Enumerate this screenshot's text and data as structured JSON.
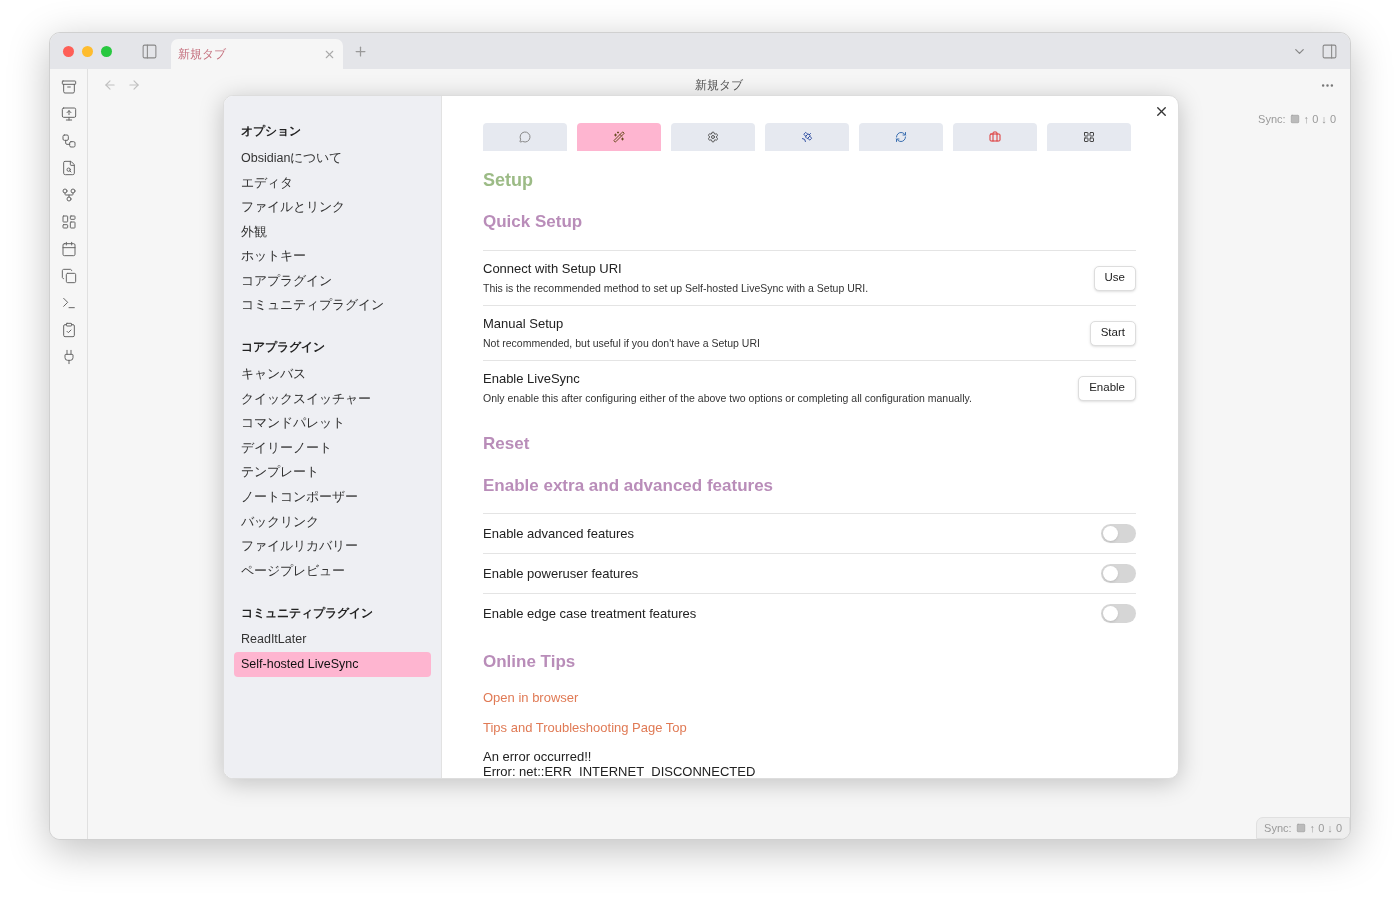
{
  "window": {
    "tab_title": "新規タブ",
    "page_title": "新規タブ"
  },
  "sync_top": {
    "label": "Sync:",
    "counts": "↑ 0 ↓ 0"
  },
  "sync_status": {
    "label": "Sync:",
    "counts": "↑ 0 ↓ 0"
  },
  "sidebar": {
    "sections": [
      {
        "heading": "オプション",
        "items": [
          {
            "label": "Obsidianについて",
            "selected": false
          },
          {
            "label": "エディタ",
            "selected": false
          },
          {
            "label": "ファイルとリンク",
            "selected": false
          },
          {
            "label": "外観",
            "selected": false
          },
          {
            "label": "ホットキー",
            "selected": false
          },
          {
            "label": "コアプラグイン",
            "selected": false
          },
          {
            "label": "コミュニティプラグイン",
            "selected": false
          }
        ]
      },
      {
        "heading": "コアプラグイン",
        "items": [
          {
            "label": "キャンバス",
            "selected": false
          },
          {
            "label": "クイックスイッチャー",
            "selected": false
          },
          {
            "label": "コマンドパレット",
            "selected": false
          },
          {
            "label": "デイリーノート",
            "selected": false
          },
          {
            "label": "テンプレート",
            "selected": false
          },
          {
            "label": "ノートコンポーザー",
            "selected": false
          },
          {
            "label": "バックリンク",
            "selected": false
          },
          {
            "label": "ファイルリカバリー",
            "selected": false
          },
          {
            "label": "ページプレビュー",
            "selected": false
          }
        ]
      },
      {
        "heading": "コミュニティプラグイン",
        "items": [
          {
            "label": "ReadItLater",
            "selected": false
          },
          {
            "label": "Self-hosted LiveSync",
            "selected": true
          }
        ]
      }
    ]
  },
  "settings_tabs": [
    {
      "selected": false
    },
    {
      "selected": true
    },
    {
      "selected": false
    },
    {
      "selected": false
    },
    {
      "selected": false
    },
    {
      "selected": false
    },
    {
      "selected": false
    }
  ],
  "content": [
    {
      "kind": "title",
      "text": "Setup",
      "color": "#9cbb86"
    },
    {
      "kind": "heading",
      "text": "Quick Setup",
      "color": "#b98db9"
    },
    {
      "kind": "button_row",
      "name": "Connect with Setup URI",
      "description": "This is the recommended method to set up Self-hosted LiveSync with a Setup URI.",
      "button": "Use"
    },
    {
      "kind": "button_row",
      "name": "Manual Setup",
      "description": "Not recommended, but useful if you don't have a Setup URI",
      "button": "Start"
    },
    {
      "kind": "button_row",
      "name": "Enable LiveSync",
      "description": "Only enable this after configuring either of the above two options or completing all configuration manually.",
      "button": "Enable"
    },
    {
      "kind": "heading",
      "text": "Reset",
      "color": "#b98db9"
    },
    {
      "kind": "heading",
      "text": "Enable extra and advanced features",
      "color": "#b98db9"
    },
    {
      "kind": "toggle_row",
      "name": "Enable advanced features",
      "on": false
    },
    {
      "kind": "toggle_row",
      "name": "Enable poweruser features",
      "on": false
    },
    {
      "kind": "toggle_row",
      "name": "Enable edge case treatment features",
      "on": false
    },
    {
      "kind": "heading",
      "text": "Online Tips",
      "color": "#b98db9"
    },
    {
      "kind": "link",
      "text": "Open in browser"
    },
    {
      "kind": "link",
      "text": "Tips and Troubleshooting Page Top"
    },
    {
      "kind": "message",
      "lines": [
        "An error occurred!!",
        "Error: net::ERR_INTERNET_DISCONNECTED"
      ]
    }
  ]
}
